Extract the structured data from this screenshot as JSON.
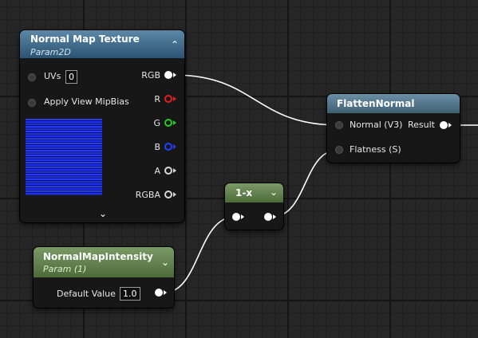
{
  "nodes": {
    "normal_map_texture": {
      "title": "Normal Map Texture",
      "subtitle": "Param2D",
      "inputs": [
        {
          "label": "UVs",
          "value": "0"
        },
        {
          "label": "Apply View MipBias"
        }
      ],
      "outputs": [
        {
          "label": "RGB",
          "color": "#ffffff"
        },
        {
          "label": "R",
          "color": "#e02020"
        },
        {
          "label": "G",
          "color": "#20d020"
        },
        {
          "label": "B",
          "color": "#2040ff"
        },
        {
          "label": "A",
          "color": "#d8d8d8"
        },
        {
          "label": "RGBA",
          "color": "#d8d8d8"
        }
      ]
    },
    "flatten_normal": {
      "title": "FlattenNormal",
      "inputs": [
        "Normal (V3)",
        "Flatness (S)"
      ],
      "output": "Result"
    },
    "one_minus": {
      "title": "1-x"
    },
    "normal_map_intensity": {
      "title": "NormalMapIntensity",
      "subtitle": "Param (1)",
      "default_label": "Default Value",
      "default_value": "1.0"
    }
  },
  "colors": {
    "header_blue": "#2b5371",
    "header_steel": "#3f5f73",
    "header_green": "#4c6b3a",
    "texture_blue": "#1d30e6",
    "wire": "#ffffff"
  }
}
